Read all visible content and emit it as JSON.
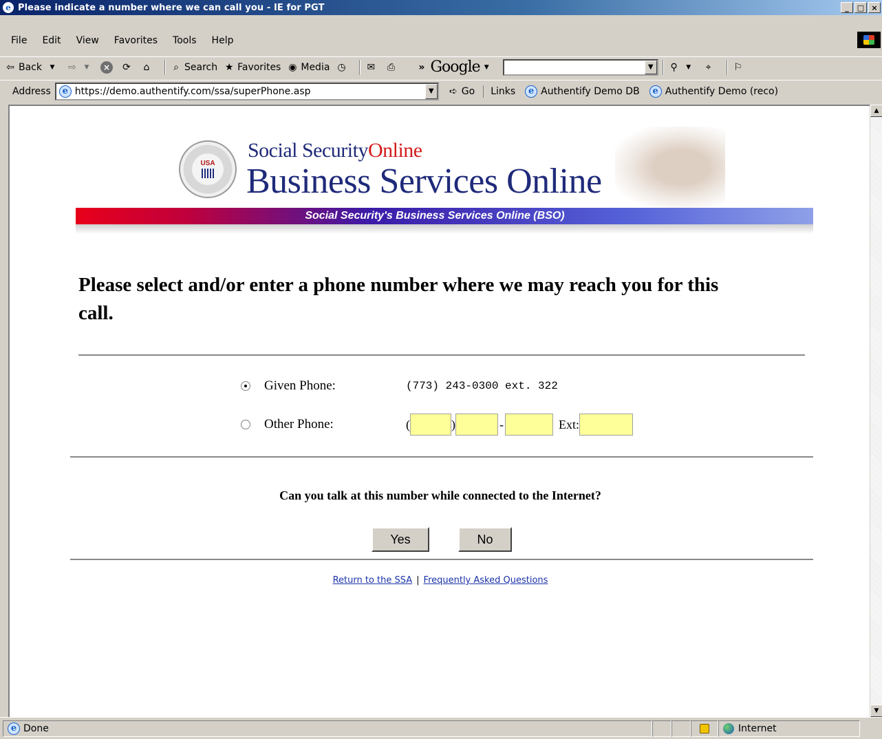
{
  "window": {
    "title": "Please indicate a number where we can call you - IE for PGT",
    "controls": [
      "_",
      "□",
      "×"
    ]
  },
  "menu": {
    "items": [
      "File",
      "Edit",
      "View",
      "Favorites",
      "Tools",
      "Help"
    ]
  },
  "toolbar": {
    "back": "Back",
    "search": "Search",
    "favorites": "Favorites",
    "media": "Media",
    "chevron": "»",
    "google_label": "Google",
    "google_query": ""
  },
  "address": {
    "label": "Address",
    "url": "https://demo.authentify.com/ssa/superPhone.asp",
    "go": "Go",
    "links_label": "Links",
    "links": [
      "Authentify Demo DB",
      "Authentify Demo (reco)"
    ]
  },
  "banner": {
    "seal_text": "USA",
    "ss_prefix": "Social Security",
    "ss_suffix": "Online",
    "title": "Business Services Online",
    "ribbon": "Social Security's Business Services Online (BSO)"
  },
  "page": {
    "headline": "Please select and/or enter a phone number where we may reach you for this call.",
    "given_label": "Given Phone:",
    "given_value": "(773) 243-0300 ext. 322",
    "other_label": "Other Phone:",
    "open_paren": "(",
    "close_paren": ")",
    "dash": "-",
    "ext_label": "Ext:",
    "area_code": "",
    "prefix": "",
    "line": "",
    "ext": "",
    "question": "Can you talk at this number while connected to the Internet?",
    "yes": "Yes",
    "no": "No",
    "link_return": "Return to the SSA",
    "link_faq": "Frequently Asked Questions",
    "link_sep": "|"
  },
  "status": {
    "text": "Done",
    "zone": "Internet"
  },
  "colors": {
    "titlebar": "#0a246a",
    "input_fill": "#ffff99",
    "link": "#1a32a8",
    "ribbon_red": "#e8001a",
    "ribbon_blue": "#3a1ba8"
  }
}
